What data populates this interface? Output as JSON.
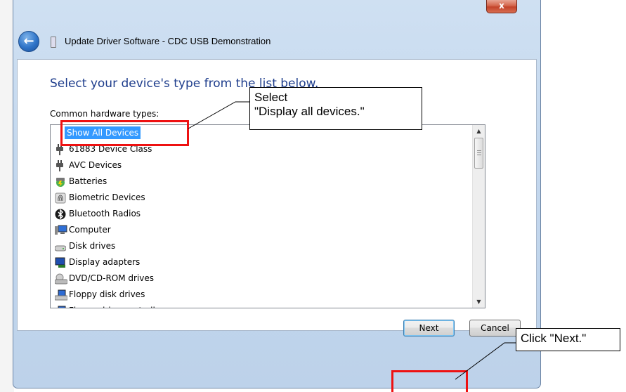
{
  "window": {
    "title": "Update Driver Software - CDC USB Demonstration",
    "close_glyph": "x",
    "back_glyph": "←"
  },
  "content": {
    "heading": "Select your device's type from the list below.",
    "list_label": "Common hardware types:",
    "items": [
      {
        "label": "Show All Devices",
        "icon": "none",
        "selected": true
      },
      {
        "label": "61883 Device Class",
        "icon": "plug-icon"
      },
      {
        "label": "AVC Devices",
        "icon": "plug-icon"
      },
      {
        "label": "Batteries",
        "icon": "battery-icon"
      },
      {
        "label": "Biometric Devices",
        "icon": "fingerprint-icon"
      },
      {
        "label": "Bluetooth Radios",
        "icon": "bluetooth-icon"
      },
      {
        "label": "Computer",
        "icon": "computer-icon"
      },
      {
        "label": "Disk drives",
        "icon": "disk-drive-icon"
      },
      {
        "label": "Display adapters",
        "icon": "display-adapter-icon"
      },
      {
        "label": "DVD/CD-ROM drives",
        "icon": "dvd-drive-icon"
      },
      {
        "label": "Floppy disk drives",
        "icon": "floppy-drive-icon"
      },
      {
        "label": "Floppy drive controllers",
        "icon": "floppy-controller-icon"
      }
    ]
  },
  "buttons": {
    "next": "Next",
    "cancel": "Cancel"
  },
  "annotations": {
    "select_callout_line1": "Select",
    "select_callout_line2": "\"Display all devices.\"",
    "next_callout": "Click \"Next.\""
  },
  "colors": {
    "highlight": "#3399ff",
    "annotation_red": "#ee1111",
    "heading_blue": "#1e3d8c"
  }
}
